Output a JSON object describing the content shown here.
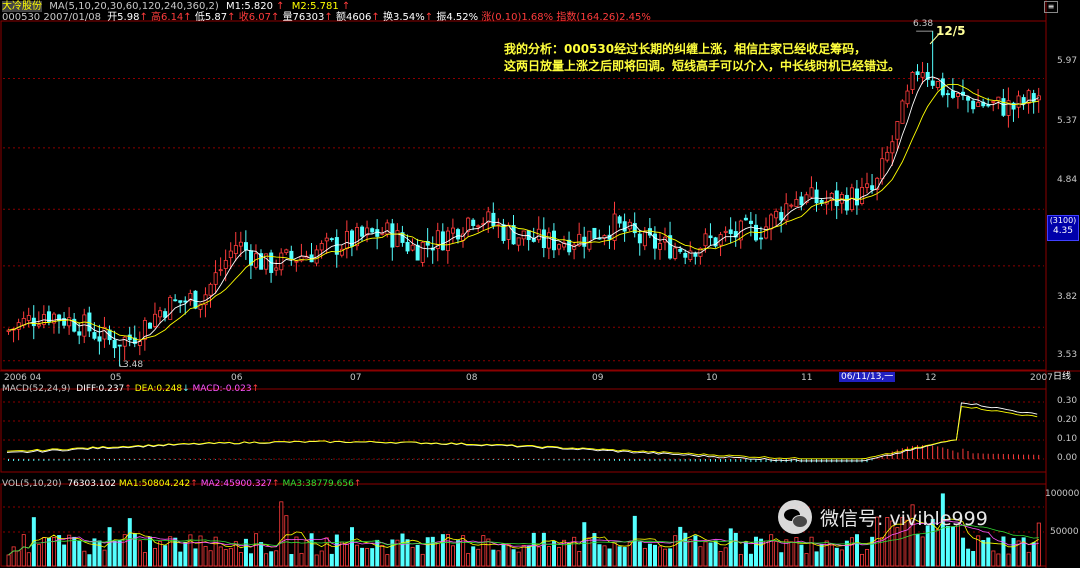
{
  "header": {
    "stock_name": "大冷股份",
    "ma_params": "MA(5,10,20,30,60,120,240,360,2)",
    "m1": "M1:5.820",
    "m2": "M2:5.781",
    "line2_code_date": "000530 2007/01/08",
    "open": "开5.98",
    "high": "高6.14",
    "low": "低5.87",
    "close": "收6.07",
    "volume": "量76303",
    "amount": "额4606",
    "turnover": "换3.54%",
    "amplitude": "振4.52%",
    "change": "涨(0.10)1.68%",
    "index": "指数(164.26)2.45%"
  },
  "annotation": {
    "line1": "我的分析：000530经过长期的纠缠上涨，相信庄家已经收足筹码，",
    "line2": "这两日放量上涨之后即将回调。短线高手可以介入，中长线时机已经错过。",
    "date_mark": "12/5"
  },
  "price_axis": {
    "labels": [
      "5.97",
      "5.37",
      "4.84",
      "4.35",
      "3.82",
      "3.53"
    ],
    "current_box_top": "(3100)",
    "current_box_bottom": "4.35",
    "high_mark": "6.38",
    "low_mark": "3.48"
  },
  "time_axis": {
    "labels": [
      "2006 04",
      "05",
      "06",
      "07",
      "08",
      "09",
      "10",
      "11",
      "12",
      "2007"
    ],
    "cursor_label": "06/11/13,一",
    "period": "日线"
  },
  "macd": {
    "title": "MACD(52,24,9)",
    "diff": "DIFF:0.237",
    "dea": "DEA:0.248",
    "macd": "MACD:-0.023",
    "axis": [
      "0.30",
      "0.20",
      "0.10",
      "0.00"
    ]
  },
  "vol": {
    "title": "VOL(5,10,20)",
    "value": "76303.102",
    "ma1": "MA1:50804.242",
    "ma2": "MA2:45900.327",
    "ma3": "MA3:38779.656",
    "axis": [
      "100000",
      "50000"
    ]
  },
  "watermark": {
    "text": "微信号: vivible999"
  },
  "colors": {
    "up": "#ff3c3c",
    "down": "#54ffff",
    "ma_white": "#ffffff",
    "ma_yellow": "#ffff00",
    "ma_magenta": "#ff55ff",
    "ma_green": "#33dd33",
    "grid": "#8b0000",
    "annotation": "#ffff3c"
  },
  "chart_data": {
    "type": "candlestick",
    "title": "大冷股份 000530 日线",
    "x_range": [
      "2006-04",
      "2007-01"
    ],
    "y_range": [
      3.48,
      6.38
    ],
    "series": [
      {
        "name": "close_approx",
        "x": [
          "2006-04",
          "2006-05",
          "2006-06",
          "2006-07",
          "2006-08",
          "2006-09",
          "2006-10",
          "2006-11",
          "2006-12",
          "2007-01"
        ],
        "values": [
          3.8,
          4.0,
          4.45,
          4.55,
          4.65,
          4.6,
          4.55,
          4.95,
          5.8,
          6.07
        ]
      }
    ]
  }
}
